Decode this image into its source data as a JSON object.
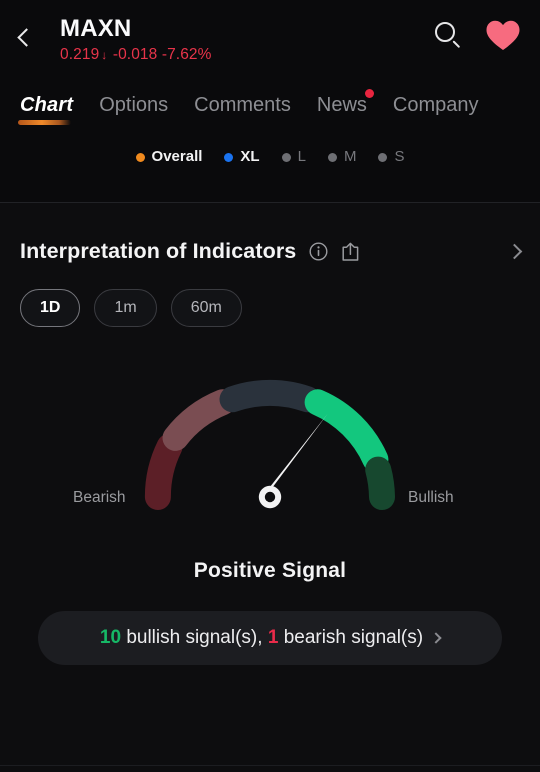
{
  "header": {
    "back_icon": "chevron-left-icon",
    "ticker": "MAXN",
    "price": "0.219",
    "arrow": "↓",
    "change": "-0.018",
    "change_pct": "-7.62%",
    "quote_color": "#e8344a",
    "search_icon": "search-icon",
    "favorite_icon": "heart-icon",
    "favorite_color": "#f76b7f"
  },
  "tabs": [
    {
      "label": "Chart",
      "active": true,
      "badge": false
    },
    {
      "label": "Options",
      "active": false,
      "badge": false
    },
    {
      "label": "Comments",
      "active": false,
      "badge": false
    },
    {
      "label": "News",
      "active": false,
      "badge": true
    },
    {
      "label": "Company",
      "active": false,
      "badge": false
    }
  ],
  "legend": [
    {
      "label": "Overall",
      "color": "#f08a1e",
      "selected": true
    },
    {
      "label": "XL",
      "color": "#1a73f0",
      "selected": true
    },
    {
      "label": "L",
      "color": "#6e6f74",
      "selected": false
    },
    {
      "label": "M",
      "color": "#6e6f74",
      "selected": false
    },
    {
      "label": "S",
      "color": "#6e6f74",
      "selected": false
    }
  ],
  "section": {
    "title": "Interpretation of Indicators",
    "info_icon": "info-circle-icon",
    "share_icon": "share-icon",
    "expand_icon": "chevron-right-icon"
  },
  "periods": [
    {
      "label": "1D",
      "active": true
    },
    {
      "label": "1m",
      "active": false
    },
    {
      "label": "60m",
      "active": false
    }
  ],
  "gauge": {
    "left_label": "Bearish",
    "right_label": "Bullish",
    "signal_label": "Positive Signal",
    "needle_value": 0.74,
    "segments": [
      {
        "name": "strong-bearish",
        "color": "#5c1f27",
        "from": 0.0,
        "to": 0.17
      },
      {
        "name": "bearish",
        "color": "#7a4d52",
        "from": 0.19,
        "to": 0.38
      },
      {
        "name": "neutral",
        "color": "#2a323c",
        "from": 0.4,
        "to": 0.6
      },
      {
        "name": "bullish",
        "color": "#13c77e",
        "from": 0.62,
        "to": 0.85
      },
      {
        "name": "strong-bullish",
        "color": "#17482f",
        "from": 0.87,
        "to": 1.0
      }
    ]
  },
  "summary": {
    "bullish_count": "10",
    "bullish_text": "bullish signal(s),",
    "bearish_count": "1",
    "bearish_text": "bearish signal(s)",
    "chevron_icon": "chevron-right-icon"
  }
}
